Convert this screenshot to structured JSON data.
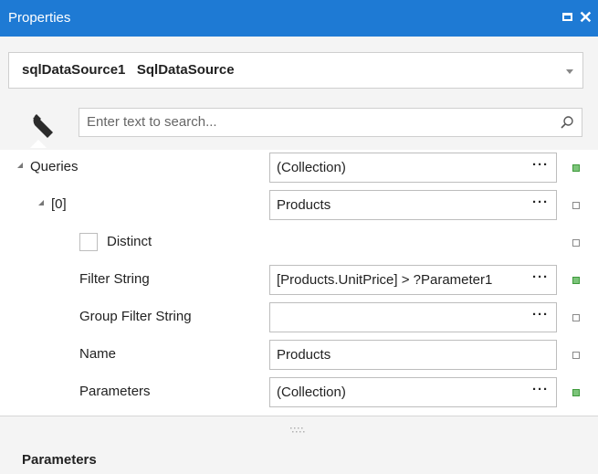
{
  "window": {
    "title": "Properties"
  },
  "object_selector": {
    "value": "sqlDataSource1   SqlDataSource"
  },
  "search": {
    "placeholder": "Enter text to search..."
  },
  "properties": {
    "queries": {
      "label": "Queries",
      "value": "(Collection)"
    },
    "item0": {
      "label": "[0]",
      "value": "Products"
    },
    "distinct": {
      "label": "Distinct"
    },
    "filter_string": {
      "label": "Filter String",
      "value": "[Products.UnitPrice] > ?Parameter1"
    },
    "group_filter_string": {
      "label": "Group Filter String",
      "value": ""
    },
    "name": {
      "label": "Name",
      "value": "Products"
    },
    "parameters": {
      "label": "Parameters",
      "value": "(Collection)"
    }
  },
  "editor_button": {
    "label": "···"
  },
  "description": {
    "title": "Parameters"
  },
  "colors": {
    "titlebar": "#1e7ad4",
    "modified_marker": "#7cc47a"
  }
}
